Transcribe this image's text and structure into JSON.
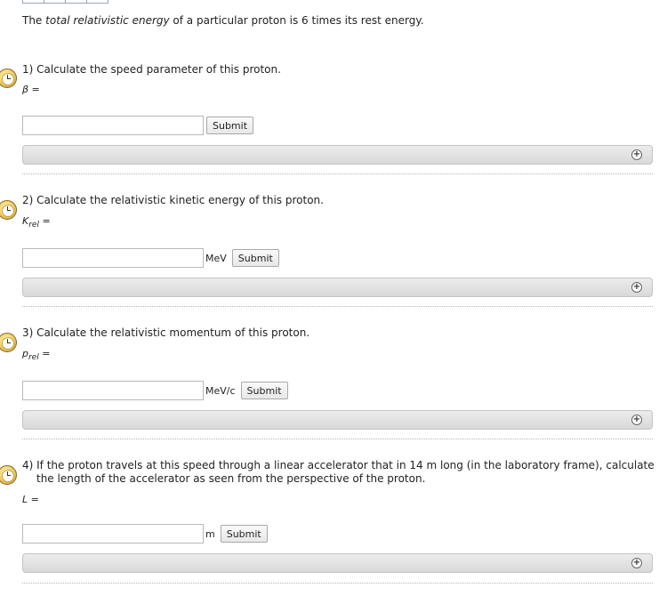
{
  "intro": {
    "prefix": "The ",
    "emphasis": "total relativistic energy",
    "suffix": " of a particular proton is 6 times its rest energy."
  },
  "questions": [
    {
      "text": "1) Calculate the speed parameter of this proton.",
      "var": "β",
      "var_sub": "",
      "eq": " =",
      "unit": "",
      "submit_label": "Submit"
    },
    {
      "text": "2) Calculate the relativistic kinetic energy of this proton.",
      "var": "K",
      "var_sub": "rel",
      "eq": " =",
      "unit": "MeV",
      "submit_label": "Submit"
    },
    {
      "text": "3) Calculate the relativistic momentum of this proton.",
      "var": "p",
      "var_sub": "rel",
      "eq": " =",
      "unit": "MeV/c",
      "submit_label": "Submit"
    },
    {
      "text_line1": "4) If the proton travels at this speed through a linear accelerator that in 14 m long (in the laboratory frame), calculate",
      "text_line2": "the length of the accelerator as seen from the perspective of the proton.",
      "var": "L",
      "var_sub": "",
      "eq": " =",
      "unit": "m",
      "submit_label": "Submit"
    }
  ],
  "icons": {
    "question": "stopwatch-icon",
    "expand": "plus-circle-icon"
  },
  "expand_symbol": "+"
}
